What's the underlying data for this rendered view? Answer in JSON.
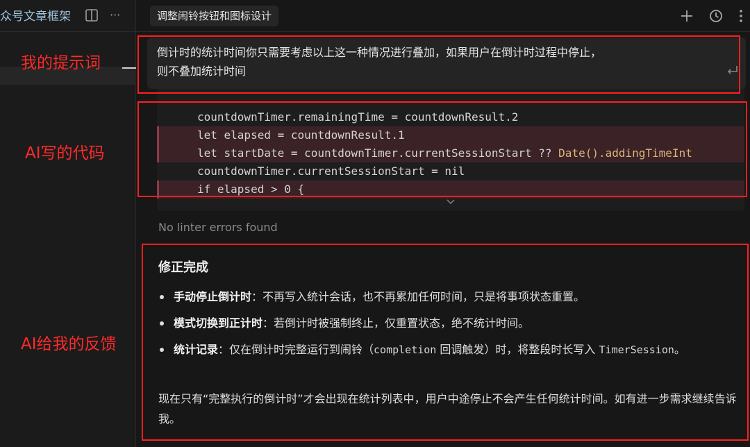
{
  "sidebar": {
    "tab_label": "众号文章框架",
    "more": "···"
  },
  "header": {
    "title": "调整闹铃按钮和图标设计"
  },
  "prompt": {
    "line1": "倒计时的统计时间你只需要考虑以上这一种情况进行叠加，如果用户在倒计时过程中停止，",
    "line2": "则不叠加统计时间"
  },
  "code": {
    "line1": "countdownTimer.remainingTime = countdownResult.2",
    "line2": "let elapsed = countdownResult.1",
    "line3_a": "let startDate = countdownTimer.currentSessionStart ?? ",
    "line3_b": "Date().addingTimeInt",
    "line4": "countdownTimer.currentSessionStart = nil",
    "line5": "if elapsed > 0 {"
  },
  "lint_status": "No linter errors found",
  "feedback": {
    "title": "修正完成",
    "b1_head": "手动停止倒计时",
    "b1_body": "：不再写入统计会话，也不再累加任何时间，只是将事项状态重置。",
    "b2_head": "模式切换到正计时",
    "b2_body": "：若倒计时被强制终止，仅重置状态，绝不统计时间。",
    "b3_head": "统计记录",
    "b3_body1": "：仅在倒计时完整运行到闹铃（",
    "b3_code1": "completion",
    "b3_body2": " 回调触发）时，将整段时长写入 ",
    "b3_code2": "TimerSession",
    "b3_body3": "。",
    "summary": "现在只有“完整执行的倒计时”才会出现在统计列表中，用户中途停止不会产生任何统计时间。如有进一步需求继续告诉我。"
  },
  "annotations": {
    "prompt_label": "我的提示词",
    "code_label": "AI写的代码",
    "feedback_label": "AI给我的反馈"
  },
  "colors": {
    "annotation": "#ff2020",
    "removed_bg": "#3a2226",
    "accent_tab": "#9ec4e0"
  }
}
